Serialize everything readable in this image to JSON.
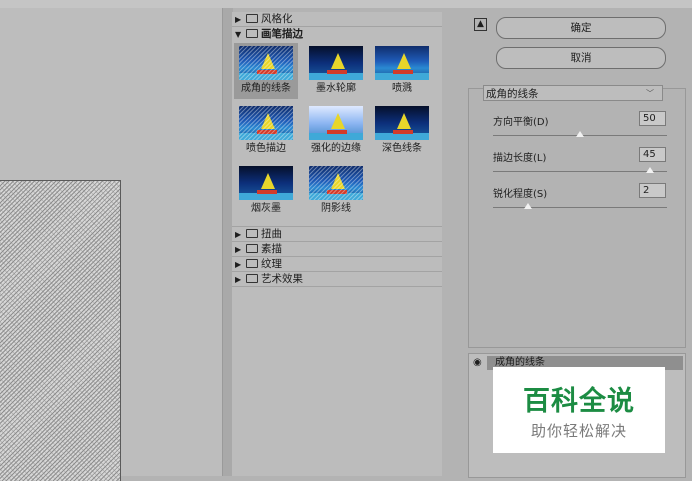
{
  "gallery": {
    "categories_top": [
      {
        "label": "风格化",
        "expanded": false
      },
      {
        "label": "画笔描边",
        "expanded": true
      }
    ],
    "thumbnails": [
      {
        "label": "成角的线条",
        "selected": true,
        "style": "hatch"
      },
      {
        "label": "墨水轮廓",
        "selected": false,
        "style": "dark"
      },
      {
        "label": "喷溅",
        "selected": false,
        "style": "normal"
      },
      {
        "label": "喷色描边",
        "selected": false,
        "style": "hatch"
      },
      {
        "label": "强化的边缘",
        "selected": false,
        "style": "light"
      },
      {
        "label": "深色线条",
        "selected": false,
        "style": "dark"
      },
      {
        "label": "烟灰墨",
        "selected": false,
        "style": "dark"
      },
      {
        "label": "阴影线",
        "selected": false,
        "style": "hatch"
      }
    ],
    "categories_bottom": [
      {
        "label": "扭曲"
      },
      {
        "label": "素描"
      },
      {
        "label": "纹理"
      },
      {
        "label": "艺术效果"
      }
    ]
  },
  "settings": {
    "collapse_icon": "▲",
    "ok_label": "确定",
    "cancel_label": "取消",
    "filter_select": "成角的线条",
    "params": [
      {
        "label": "方向平衡(D)",
        "value": "50",
        "level": 0.5
      },
      {
        "label": "描边长度(L)",
        "value": "45",
        "level": 0.9
      },
      {
        "label": "锐化程度(S)",
        "value": "2",
        "level": 0.2
      }
    ]
  },
  "layers": {
    "eye_icon": "◉",
    "layer_name": "成角的线条"
  },
  "watermark": {
    "title": "百科全说",
    "subtitle": "助你轻松解决"
  }
}
